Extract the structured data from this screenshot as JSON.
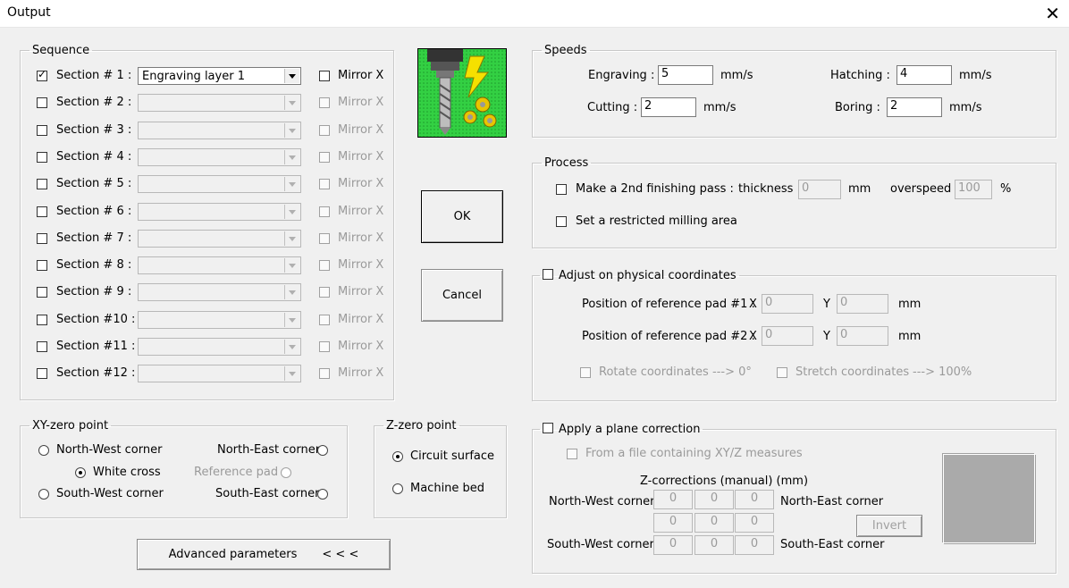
{
  "window": {
    "title": "Output",
    "close_glyph": "✕"
  },
  "sequence": {
    "legend": "Sequence",
    "mirror_label": "Mirror X",
    "sections": [
      {
        "label": "Section # 1 :",
        "checked": true,
        "value": "Engraving layer 1",
        "enabled": true
      },
      {
        "label": "Section # 2 :",
        "checked": false,
        "value": "",
        "enabled": false
      },
      {
        "label": "Section # 3 :",
        "checked": false,
        "value": "",
        "enabled": false
      },
      {
        "label": "Section # 4 :",
        "checked": false,
        "value": "",
        "enabled": false
      },
      {
        "label": "Section # 5 :",
        "checked": false,
        "value": "",
        "enabled": false
      },
      {
        "label": "Section # 6 :",
        "checked": false,
        "value": "",
        "enabled": false
      },
      {
        "label": "Section # 7 :",
        "checked": false,
        "value": "",
        "enabled": false
      },
      {
        "label": "Section # 8 :",
        "checked": false,
        "value": "",
        "enabled": false
      },
      {
        "label": "Section # 9 :",
        "checked": false,
        "value": "",
        "enabled": false
      },
      {
        "label": "Section #10 :",
        "checked": false,
        "value": "",
        "enabled": false
      },
      {
        "label": "Section #11 :",
        "checked": false,
        "value": "",
        "enabled": false
      },
      {
        "label": "Section #12 :",
        "checked": false,
        "value": "",
        "enabled": false
      }
    ]
  },
  "buttons": {
    "ok": "OK",
    "cancel": "Cancel",
    "advanced": "Advanced parameters",
    "advanced_arrows": "< < <",
    "invert": "Invert"
  },
  "speeds": {
    "legend": "Speeds",
    "engraving_label": "Engraving :",
    "engraving_value": "5",
    "hatching_label": "Hatching :",
    "hatching_value": "4",
    "cutting_label": "Cutting :",
    "cutting_value": "2",
    "boring_label": "Boring :",
    "boring_value": "2",
    "unit": "mm/s"
  },
  "process": {
    "legend": "Process",
    "finishing_label": "Make a 2nd finishing pass :",
    "thickness_label": "thickness",
    "thickness_value": "0",
    "thickness_unit": "mm",
    "overspeed_label": "overspeed",
    "overspeed_value": "100",
    "overspeed_unit": "%",
    "restricted_label": "Set a restricted milling area"
  },
  "physical": {
    "legend": "Adjust on physical coordinates",
    "pad1_label": "Position of reference pad #1 :",
    "pad2_label": "Position of reference pad #2 :",
    "x_label": "X",
    "y_label": "Y",
    "unit": "mm",
    "pad1_x": "0",
    "pad1_y": "0",
    "pad2_x": "0",
    "pad2_y": "0",
    "rotate_label": "Rotate coordinates",
    "rotate_value": "---> 0°",
    "stretch_label": "Stretch coordinates",
    "stretch_value": "---> 100%"
  },
  "xyzero": {
    "legend": "XY-zero point",
    "nw": "North-West corner",
    "ne": "North-East corner",
    "white_cross": "White cross",
    "ref_pad": "Reference pad",
    "sw": "South-West corner",
    "se": "South-East corner"
  },
  "zzero": {
    "legend": "Z-zero point",
    "circuit": "Circuit surface",
    "machine": "Machine bed"
  },
  "plane": {
    "legend": "Apply a plane correction",
    "file_label": "From a file containing XY/Z measures",
    "zcorr_label": "Z-corrections (manual) (mm)",
    "nw": "North-West corner",
    "ne": "North-East corner",
    "sw": "South-West corner",
    "se": "South-East corner",
    "grid": [
      [
        "0",
        "0",
        "0"
      ],
      [
        "0",
        "0",
        "0"
      ],
      [
        "0",
        "0",
        "0"
      ]
    ]
  },
  "colors": {
    "icon_bg": "#2ecc40",
    "bolt": "#f5e000",
    "gear": "#e8c400",
    "preview": "#aaaaaa"
  }
}
